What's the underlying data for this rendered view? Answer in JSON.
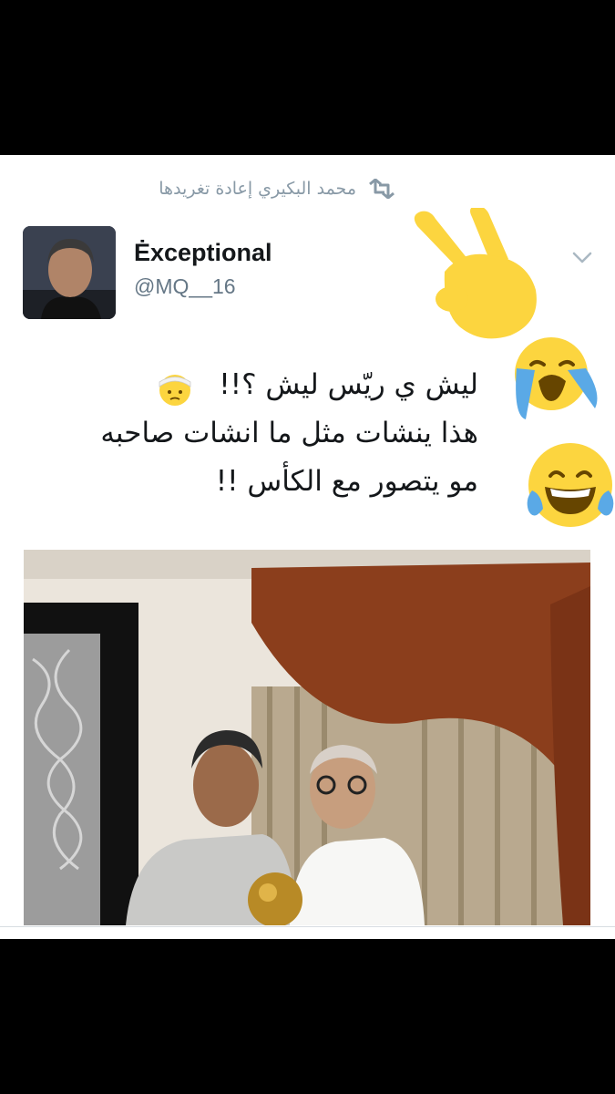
{
  "retweet": {
    "text": "محمد البكيري إعادة تغريدها",
    "icon": "retweet-icon"
  },
  "author": {
    "display_name": "Ėxceptional",
    "handle": "@MQ__16"
  },
  "tweet": {
    "lines": [
      "ليش ي ريّس ليش ؟!!",
      "هذا ينشات مثل ما انشات صاحبه",
      "مو يتصور مع الكأس !!"
    ]
  },
  "icons": {
    "menu": "chevron-down-icon",
    "pointing": "pointing-hand-emoji",
    "crying": "loudly-crying-face-emoji",
    "joy": "face-with-tears-of-joy-emoji",
    "bandage": "face-with-head-bandage-emoji"
  },
  "colors": {
    "text": "#14171a",
    "muted": "#8899a6",
    "emoji_yellow": "#fcd53f",
    "tears": "#5aa9e6"
  }
}
